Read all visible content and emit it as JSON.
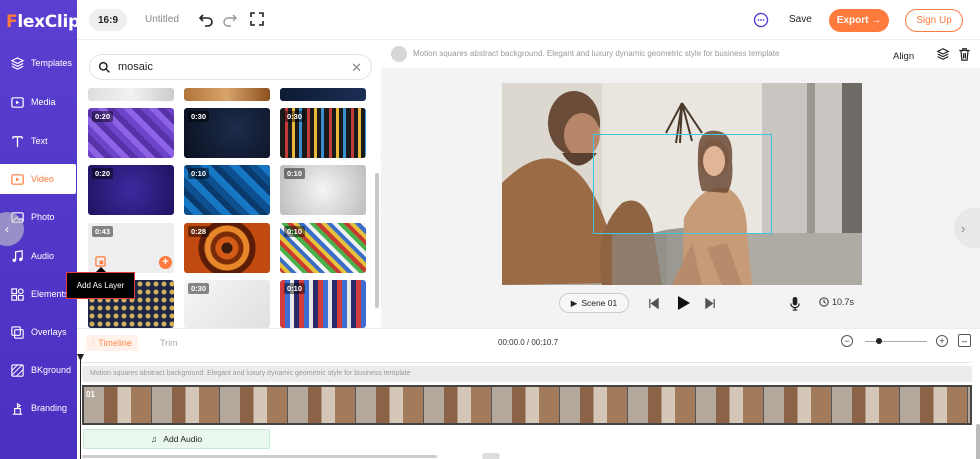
{
  "app": {
    "logo_first": "F",
    "logo_rest": "lexClip"
  },
  "sidebar": {
    "items": [
      {
        "label": "Templates",
        "icon": "layers-icon"
      },
      {
        "label": "Media",
        "icon": "media-icon"
      },
      {
        "label": "Text",
        "icon": "text-icon"
      },
      {
        "label": "Video",
        "icon": "video-icon",
        "active": true
      },
      {
        "label": "Photo",
        "icon": "photo-icon"
      },
      {
        "label": "Audio",
        "icon": "music-icon"
      },
      {
        "label": "Elements",
        "icon": "elements-icon"
      },
      {
        "label": "Overlays",
        "icon": "overlays-icon"
      },
      {
        "label": "BKground",
        "icon": "background-icon"
      },
      {
        "label": "Branding",
        "icon": "branding-icon"
      }
    ]
  },
  "topbar": {
    "ratio": "16:9",
    "title": "Untitled",
    "save_label": "Save",
    "export_label": "Export →",
    "signup_label": "Sign Up"
  },
  "media_panel": {
    "search_value": "mosaic",
    "clear_label": "✕",
    "thumbnails": [
      {
        "duration": "0:20"
      },
      {
        "duration": "0:30"
      },
      {
        "duration": "0:30"
      },
      {
        "duration": "0:20"
      },
      {
        "duration": "0:10"
      },
      {
        "duration": "0:10"
      },
      {
        "duration": "0:43"
      },
      {
        "duration": "0:28"
      },
      {
        "duration": "0:10"
      },
      {
        "duration": ""
      },
      {
        "duration": "0:30"
      },
      {
        "duration": "0:10"
      }
    ],
    "tooltip": "Add As Layer"
  },
  "preview": {
    "caption": "Motion squares abstract background. Elegant and luxury dynamic geometric style for business template",
    "align_label": "Align",
    "scene_label": "Scene 01",
    "duration": "10.7s"
  },
  "timeline": {
    "tab_timeline": "Timeline",
    "tab_trim": "Trim",
    "timecode": "00:00.0 / 00:10.7",
    "track_label": "Motion squares abstract background. Elegant and luxury dynamic geometric style for business template",
    "add_audio_label": "Add Audio",
    "clip_marker": "01"
  },
  "colors": {
    "accent": "#ff7a3d",
    "sidebar": "#5a3fd0",
    "selection": "#3ec6e0"
  }
}
